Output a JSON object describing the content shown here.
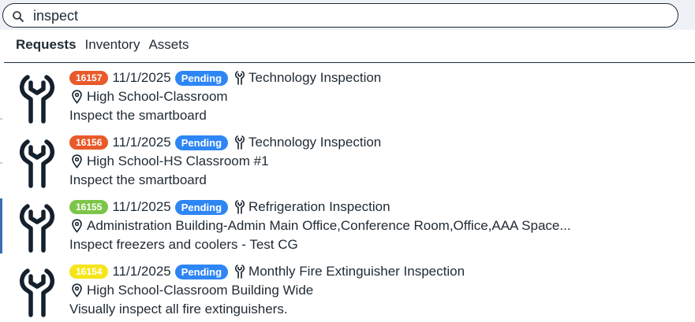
{
  "search": {
    "value": "inspect"
  },
  "tabs": [
    {
      "label": "Requests",
      "active": true
    },
    {
      "label": "Inventory",
      "active": false
    },
    {
      "label": "Assets",
      "active": false
    }
  ],
  "colors": {
    "status_pending": "#2e86f5",
    "badge_red": "#e85a2a",
    "badge_green": "#7dc549",
    "badge_yellow": "#f6e51a"
  },
  "results": [
    {
      "id": "16157",
      "id_color": "#e85a2a",
      "id_text_color": "#ffffff",
      "date": "11/1/2025",
      "status": "Pending",
      "type": "Technology Inspection",
      "location": "High School-Classroom",
      "description": "Inspect the smartboard"
    },
    {
      "id": "16156",
      "id_color": "#e85a2a",
      "id_text_color": "#ffffff",
      "date": "11/1/2025",
      "status": "Pending",
      "type": "Technology Inspection",
      "location": "High School-HS Classroom #1",
      "description": "Inspect the smartboard"
    },
    {
      "id": "16155",
      "id_color": "#7dc549",
      "id_text_color": "#ffffff",
      "date": "11/1/2025",
      "status": "Pending",
      "type": "Refrigeration Inspection",
      "location": "Administration Building-Admin Main Office,Conference Room,Office,AAA Space...",
      "description": "Inspect freezers and coolers - Test CG"
    },
    {
      "id": "16154",
      "id_color": "#f6e51a",
      "id_text_color": "#ffffff",
      "date": "11/1/2025",
      "status": "Pending",
      "type": "Monthly Fire Extinguisher Inspection",
      "location": "High School-Classroom Building Wide",
      "description": "Visually inspect all fire extinguishers."
    }
  ]
}
